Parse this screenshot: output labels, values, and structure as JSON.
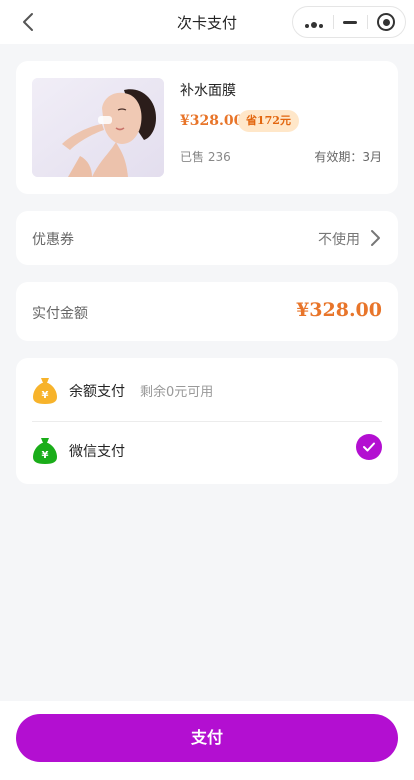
{
  "nav": {
    "title": "次卡支付",
    "back_icon": "chevron-left-icon",
    "more_icon": "more-dots-icon",
    "minimize_icon": "minimize-icon",
    "close_icon": "target-circle-icon"
  },
  "product": {
    "name": "补水面膜",
    "price": "¥328.00",
    "save_badge": "省172元",
    "sold": "已售 236",
    "validity": "有效期：3月",
    "image": "woman-face-mask-photo"
  },
  "coupon": {
    "label": "优惠券",
    "value": "不使用"
  },
  "amount": {
    "label": "实付金额",
    "value": "¥328.00"
  },
  "payment": {
    "balance": {
      "label": "余额支付",
      "sub": "剩余0元可用",
      "icon": "money-bag-icon",
      "icon_color": "#f7b32b"
    },
    "wechat": {
      "label": "微信支付",
      "icon": "money-bag-icon",
      "icon_color": "#1aad19",
      "selected": true
    }
  },
  "bottom": {
    "pay_button": "支付"
  },
  "colors": {
    "accent": "#b30fd1",
    "price": "#e8752a",
    "badge_bg": "#ffe7c9"
  }
}
